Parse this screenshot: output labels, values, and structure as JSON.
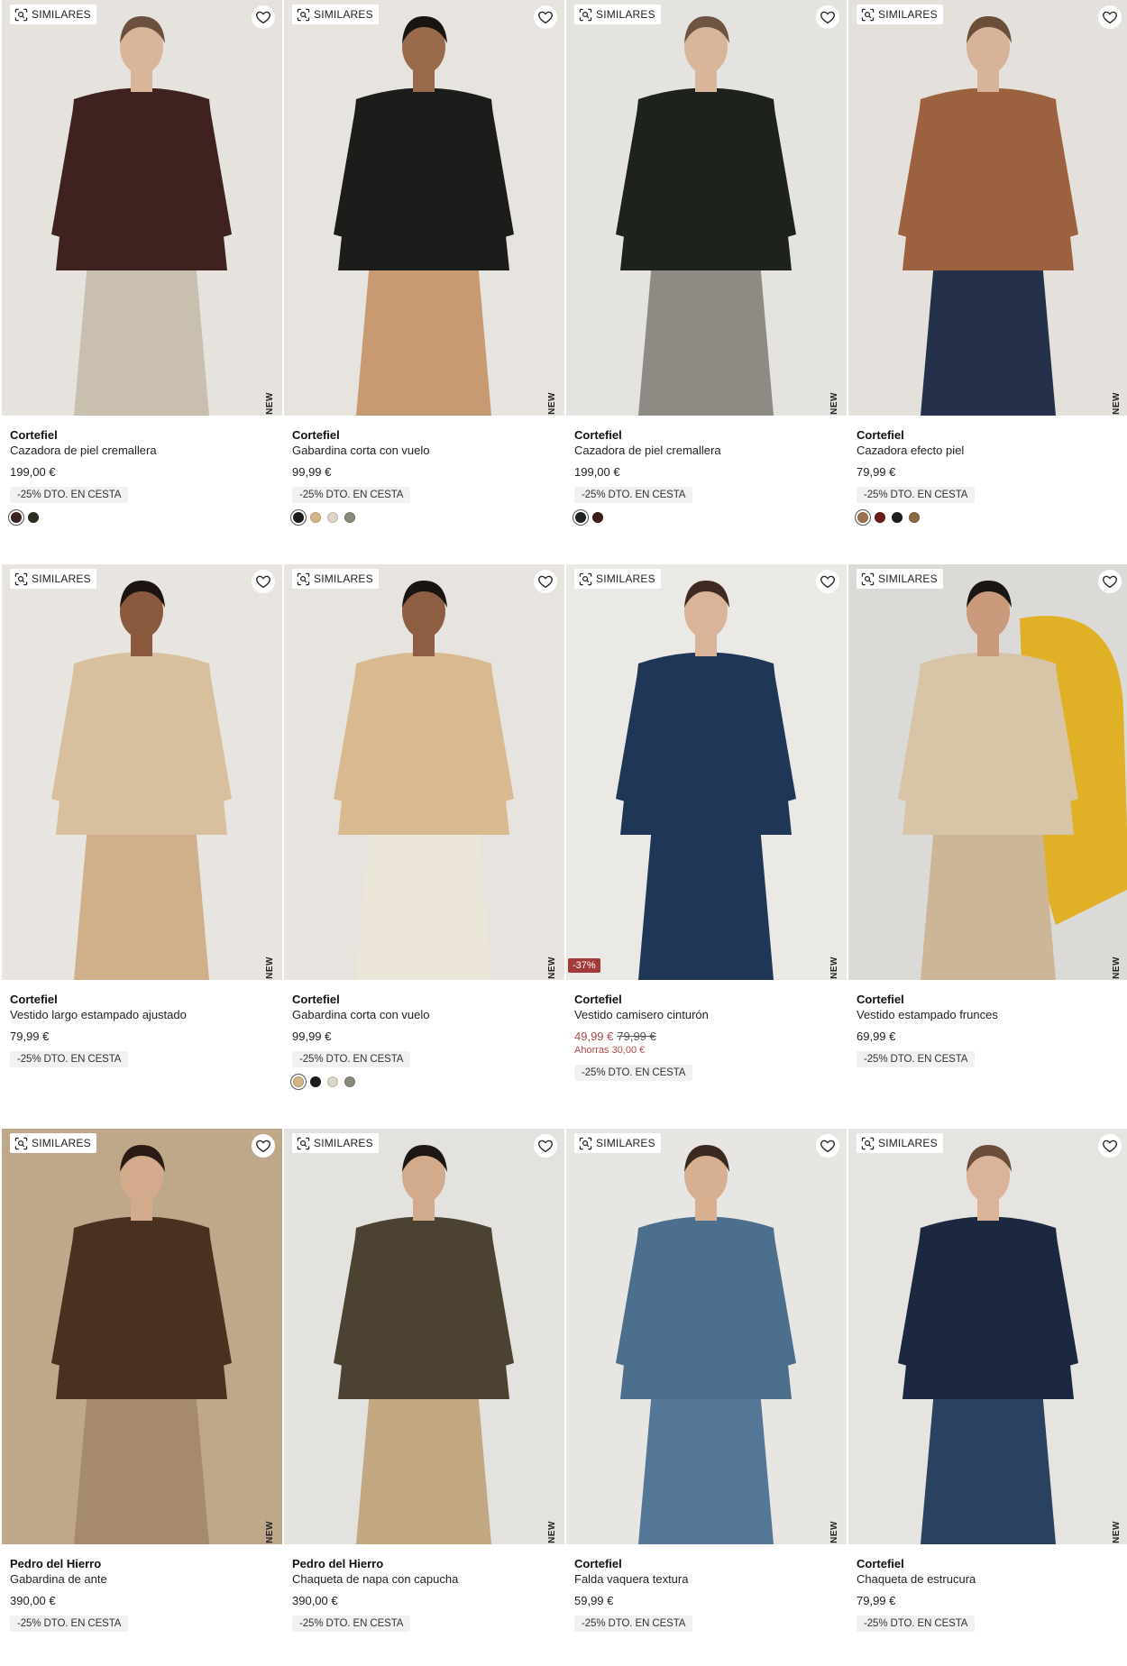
{
  "labels": {
    "similares": "SIMILARES",
    "new": "NEW"
  },
  "products": [
    {
      "brand": "Cortefiel",
      "name": "Cazadora de piel cremallera",
      "price": "199,00 €",
      "promo": "-25% DTO. EN CESTA",
      "colors": [
        "#3b2420",
        "#2b2e22"
      ],
      "photo": {
        "bg": "#e6e2dd",
        "top": "#3f2220",
        "bottom": "#c9bfae",
        "skin": "#d9b59a",
        "hair": "#6b5040"
      }
    },
    {
      "brand": "Cortefiel",
      "name": "Gabardina corta con vuelo",
      "price": "99,99 €",
      "promo": "-25% DTO. EN CESTA",
      "colors": [
        "#1d1d1d",
        "#d5b48a",
        "#ddd6c8",
        "#8c8a7d"
      ],
      "photo": {
        "bg": "#e7e4df",
        "top": "#1c1c1a",
        "bottom": "#c79a72",
        "skin": "#9a6a4c",
        "hair": "#1a1410"
      }
    },
    {
      "brand": "Cortefiel",
      "name": "Cazadora de piel cremallera",
      "price": "199,00 €",
      "promo": "-25% DTO. EN CESTA",
      "colors": [
        "#1f2520",
        "#3b1e18"
      ],
      "photo": {
        "bg": "#e5e3df",
        "top": "#1e221d",
        "bottom": "#8e8b85",
        "skin": "#d9b59a",
        "hair": "#6e5442"
      }
    },
    {
      "brand": "Cortefiel",
      "name": "Cazadora efecto piel",
      "price": "79,99 €",
      "promo": "-25% DTO. EN CESTA",
      "colors": [
        "#a0704e",
        "#6a1a1a",
        "#1e1e1e",
        "#8a6a44"
      ],
      "photo": {
        "bg": "#e4e1dc",
        "top": "#9c6240",
        "bottom": "#25304a",
        "skin": "#d7b39a",
        "hair": "#6a4e3a"
      }
    },
    {
      "brand": "Cortefiel",
      "name": "Vestido largo estampado ajustado",
      "price": "79,99 €",
      "promo": "-25% DTO. EN CESTA",
      "colors": [],
      "photo": {
        "bg": "#e8e5e0",
        "top": "#d8bf9e",
        "bottom": "#cfb08a",
        "skin": "#8b5a3e",
        "hair": "#1c1410"
      }
    },
    {
      "brand": "Cortefiel",
      "name": "Gabardina corta con vuelo",
      "price": "99,99 €",
      "promo": "-25% DTO. EN CESTA",
      "colors": [
        "#d5b48a",
        "#1d1d1d",
        "#ddd6c8",
        "#8c8a7d"
      ],
      "photo": {
        "bg": "#e7e4e0",
        "top": "#d9b990",
        "bottom": "#ece6d8",
        "skin": "#8e5e42",
        "hair": "#1a1410"
      }
    },
    {
      "brand": "Cortefiel",
      "name": "Vestido camisero cinturón",
      "price_sale": "49,99 €",
      "price_old": "79,99 €",
      "savings": "Ahorras 30,00 €",
      "discount_badge": "-37%",
      "promo": "-25% DTO. EN CESTA",
      "colors": [],
      "photo": {
        "bg": "#ebe9e6",
        "top": "#1f3656",
        "bottom": "#1f3656",
        "skin": "#d9b39a",
        "hair": "#3e2a20"
      }
    },
    {
      "brand": "Cortefiel",
      "name": "Vestido estampado frunces",
      "price": "69,99 €",
      "promo": "-25% DTO. EN CESTA",
      "colors": [],
      "photo": {
        "bg": "#dcdad7",
        "top": "#d8c4a6",
        "bottom": "#cdb597",
        "skin": "#c99a7c",
        "hair": "#1a1614",
        "accent": "#e0b026"
      }
    },
    {
      "brand": "Pedro del Hierro",
      "name": "Gabardina de ante",
      "price": "390,00 €",
      "promo": "-25% DTO. EN CESTA",
      "colors": [],
      "photo": {
        "bg": "#bfa88a",
        "top": "#4a3020",
        "bottom": "#a58b6c",
        "skin": "#d3ab8c",
        "hair": "#2a1c14"
      }
    },
    {
      "brand": "Pedro del Hierro",
      "name": "Chaqueta de napa con capucha",
      "price": "390,00 €",
      "promo": "-25% DTO. EN CESTA",
      "colors": [],
      "photo": {
        "bg": "#e4e2df",
        "top": "#4b4232",
        "bottom": "#c2a882",
        "skin": "#d2aa8c",
        "hair": "#1e1612"
      }
    },
    {
      "brand": "Cortefiel",
      "name": "Falda vaquera textura",
      "price": "59,99 €",
      "promo": "-25% DTO. EN CESTA",
      "colors": [],
      "photo": {
        "bg": "#e8e6e2",
        "top": "#4d6f8e",
        "bottom": "#557797",
        "skin": "#d6b091",
        "hair": "#3a2a20"
      }
    },
    {
      "brand": "Cortefiel",
      "name": "Chaqueta de estrucura",
      "price": "79,99 €",
      "promo": "-25% DTO. EN CESTA",
      "colors": [],
      "photo": {
        "bg": "#e6e4e1",
        "top": "#1c2740",
        "bottom": "#2a4160",
        "skin": "#d9b39a",
        "hair": "#6a4e3a"
      }
    }
  ]
}
